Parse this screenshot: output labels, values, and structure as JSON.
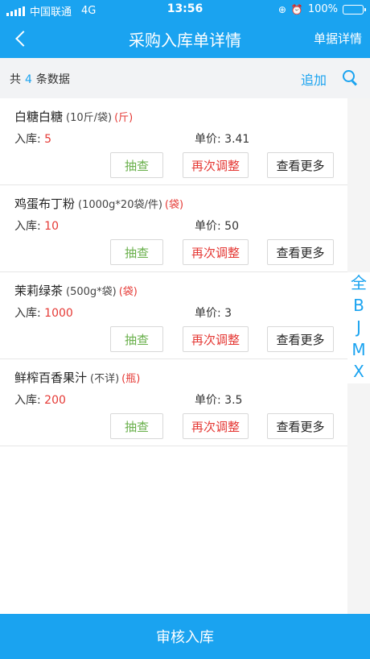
{
  "status": {
    "carrier": "中国联通",
    "network": "4G",
    "time": "13:56",
    "battery": "100%"
  },
  "nav": {
    "title": "采购入库单详情",
    "right": "单据详情"
  },
  "summary": {
    "prefix": "共",
    "count": "4",
    "suffix": "条数据",
    "add": "追加"
  },
  "items": [
    {
      "name": "白糖白糖",
      "spec": "(10斤/袋)",
      "unit": "(斤)",
      "qty_label": "入库:",
      "qty": "5",
      "price_label": "单价:",
      "price": "3.41"
    },
    {
      "name": "鸡蛋布丁粉",
      "spec": "(1000g*20袋/件)",
      "unit": "(袋)",
      "qty_label": "入库:",
      "qty": "10",
      "price_label": "单价:",
      "price": "50"
    },
    {
      "name": "茉莉绿茶",
      "spec": "(500g*袋)",
      "unit": "(袋)",
      "qty_label": "入库:",
      "qty": "1000",
      "price_label": "单价:",
      "price": "3"
    },
    {
      "name": "鲜榨百香果汁",
      "spec": "(不详)",
      "unit": "(瓶)",
      "qty_label": "入库:",
      "qty": "200",
      "price_label": "单价:",
      "price": "3.5"
    }
  ],
  "buttons": {
    "check": "抽查",
    "adjust": "再次调整",
    "more": "查看更多"
  },
  "index": [
    "全",
    "B",
    "J",
    "M",
    "X"
  ],
  "bottom": {
    "label": "审核入库"
  },
  "colors": {
    "primary": "#1aa3f0",
    "red": "#e53935",
    "green": "#6ab04c"
  }
}
